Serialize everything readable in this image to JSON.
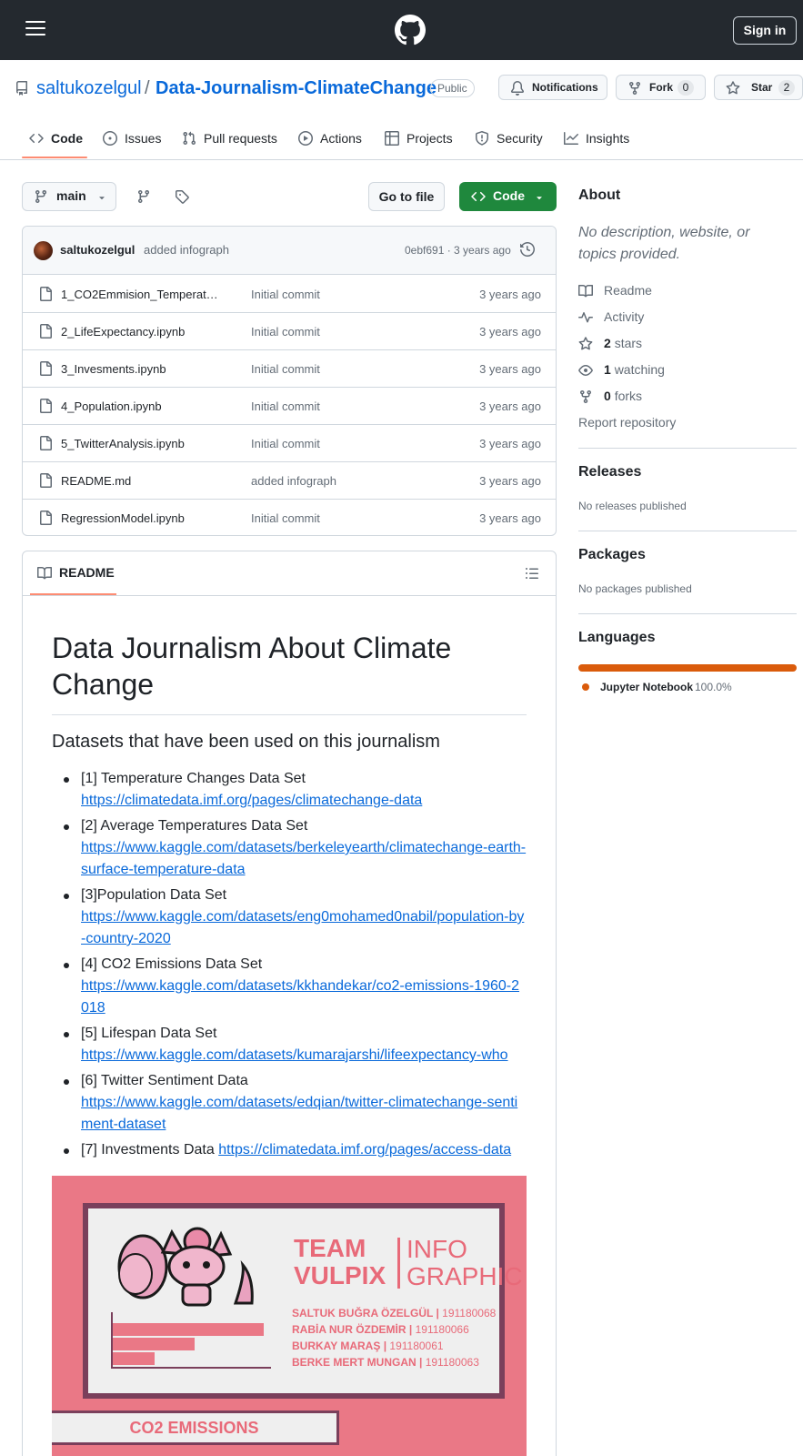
{
  "header": {
    "sign_in": "Sign in"
  },
  "repo": {
    "owner": "saltukozelgul",
    "slash": "/",
    "name": "Data-Journalism-ClimateChange",
    "visibility": "Public",
    "notifications_label": "Notifications",
    "fork_label": "Fork",
    "fork_count": "0",
    "star_label": "Star",
    "star_count": "2"
  },
  "tabs": [
    {
      "label": "Code",
      "icon": "code-icon",
      "active": true
    },
    {
      "label": "Issues",
      "icon": "issue-icon"
    },
    {
      "label": "Pull requests",
      "icon": "pull-request-icon"
    },
    {
      "label": "Actions",
      "icon": "play-icon"
    },
    {
      "label": "Projects",
      "icon": "table-icon"
    },
    {
      "label": "Security",
      "icon": "shield-icon"
    },
    {
      "label": "Insights",
      "icon": "graph-icon"
    }
  ],
  "toolbar": {
    "branch": "main",
    "go_to_file": "Go to file",
    "code": "Code"
  },
  "latest_commit": {
    "user": "saltukozelgul",
    "message": "added infograph",
    "meta": "0ebf691 · 3 years ago"
  },
  "files": [
    {
      "name": "1_CO2Emmision_Temperat…",
      "commit": "Initial commit",
      "date": "3 years ago"
    },
    {
      "name": "2_LifeExpectancy.ipynb",
      "commit": "Initial commit",
      "date": "3 years ago"
    },
    {
      "name": "3_Invesments.ipynb",
      "commit": "Initial commit",
      "date": "3 years ago"
    },
    {
      "name": "4_Population.ipynb",
      "commit": "Initial commit",
      "date": "3 years ago"
    },
    {
      "name": "5_TwitterAnalysis.ipynb",
      "commit": "Initial commit",
      "date": "3 years ago"
    },
    {
      "name": "README.md",
      "commit": "added infograph",
      "date": "3 years ago"
    },
    {
      "name": "RegressionModel.ipynb",
      "commit": "Initial commit",
      "date": "3 years ago"
    }
  ],
  "readme": {
    "tab_label": "README",
    "title": "Data Journalism About Climate Change",
    "subtitle": "Datasets that have been used on this journalism",
    "datasets": [
      {
        "label": "[1] Temperature Changes Data Set",
        "url": "https://climatedata.imf.org/pages/climatechange-data"
      },
      {
        "label": "[2] Average Temperatures Data Set",
        "url": "https://www.kaggle.com/datasets/berkeleyearth/climatechange-earth-surface-temperature-data"
      },
      {
        "label": "[3]Population Data Set",
        "url": "https://www.kaggle.com/datasets/eng0mohamed0nabil/population-by-country-2020"
      },
      {
        "label": "[4] CO2 Emissions Data Set",
        "url": "https://www.kaggle.com/datasets/kkhandekar/co2-emissions-1960-2018"
      },
      {
        "label": "[5] Lifespan Data Set",
        "url": "https://www.kaggle.com/datasets/kumarajarshi/lifeexpectancy-who"
      },
      {
        "label": "[6] Twitter Sentiment Data",
        "url": "https://www.kaggle.com/datasets/edqian/twitter-climatechange-sentiment-dataset"
      },
      {
        "label": "[7] Investments Data",
        "url": "https://climatedata.imf.org/pages/access-data"
      }
    ],
    "infographic": {
      "team": "TEAM",
      "vulpix": "VULPIX",
      "info": "INFO",
      "graphic": "GRAPHIC",
      "members": [
        {
          "name": "SALTUK BUĞRA ÖZELGÜL",
          "id": "191180068"
        },
        {
          "name": "RABİA NUR ÖZDEMİR",
          "id": "191180066"
        },
        {
          "name": "BURKAY MARAŞ",
          "id": "191180061"
        },
        {
          "name": "BERKE MERT MUNGAN",
          "id": "191180063"
        }
      ],
      "banner": "CO2 EMISSIONS"
    }
  },
  "sidebar": {
    "about_title": "About",
    "about_desc": "No description, website, or topics provided.",
    "readme": "Readme",
    "activity": "Activity",
    "stars_count": "2",
    "stars_label": "stars",
    "watching_count": "1",
    "watching_label": "watching",
    "forks_count": "0",
    "forks_label": "forks",
    "report": "Report repository",
    "releases_title": "Releases",
    "releases_text": "No releases published",
    "packages_title": "Packages",
    "packages_text": "No packages published",
    "languages_title": "Languages",
    "language_name": "Jupyter Notebook",
    "language_pct": "100.0%"
  },
  "colors": {
    "header_bg": "#24292f",
    "accent_green": "#1f883d",
    "link_blue": "#0969da",
    "jupyter_orange": "#da5b0b",
    "tab_underline": "#fd8c73"
  }
}
